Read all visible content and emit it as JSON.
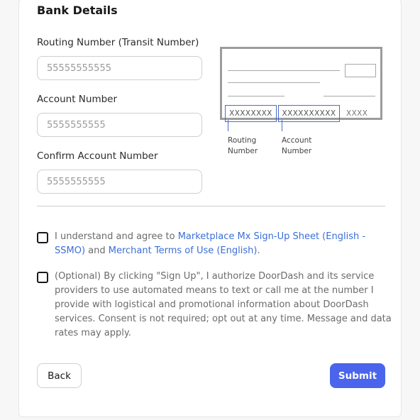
{
  "section": {
    "title": "Bank Details"
  },
  "fields": {
    "routing": {
      "label": "Routing Number (Transit Number)",
      "placeholder": "55555555555"
    },
    "account": {
      "label": "Account Number",
      "placeholder": "5555555555"
    },
    "confirm": {
      "label": "Confirm Account Number",
      "placeholder": "5555555555"
    }
  },
  "check_illustration": {
    "routing_mask": "XXXXXXXX",
    "account_mask": "XXXXXXXXXX",
    "check_mask": "XXXX",
    "routing_caption": [
      "Routing",
      "Number"
    ],
    "account_caption": [
      "Account",
      "Number"
    ],
    "highlight_color": "#4a6cc7"
  },
  "agreements": {
    "terms": {
      "prefix": "I understand and agree to ",
      "link1": "Marketplace Mx Sign-Up Sheet (English -",
      "link1_cont": "SSMO)",
      "middle": " and ",
      "link2": "Merchant Terms of Use (English)",
      "suffix": "."
    },
    "sms": {
      "lines": [
        "(Optional) By clicking \"Sign Up\", I authorize DoorDash and its service",
        "providers to use automated means to text or call me at the number I",
        "provide with logistical and promotional information about DoorDash",
        "services. Consent is not required; opt out at any time. Message and data",
        "rates may apply."
      ]
    }
  },
  "buttons": {
    "back": "Back",
    "submit": "Submit"
  },
  "colors": {
    "primary": "#4a65ec",
    "link": "#3b6fd8"
  }
}
